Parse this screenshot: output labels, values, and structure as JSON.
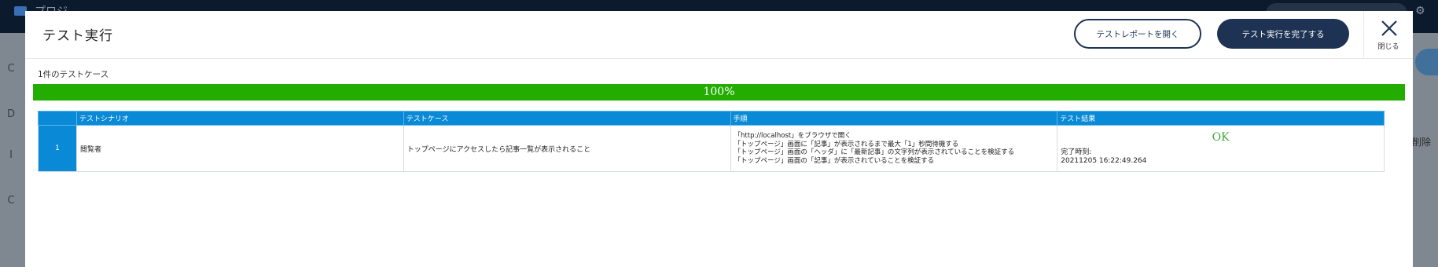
{
  "background": {
    "project_label": "プロジ",
    "left_marks": [
      "C",
      "D",
      "I",
      "C"
    ],
    "right_text": "削除"
  },
  "modal": {
    "title": "テスト実行",
    "report_button": "テストレポートを開く",
    "complete_button": "テスト実行を完了する",
    "close_label": "閉じる"
  },
  "summary": {
    "case_count": "1件のテストケース",
    "progress_percent": 100,
    "progress_text": "100%"
  },
  "table": {
    "headers": [
      "",
      "テストシナリオ",
      "テストケース",
      "手順",
      "テスト結果"
    ],
    "rows": [
      {
        "number": "1",
        "scenario": "閲覧者",
        "case": "トップページにアクセスしたら記事一覧が表示されること",
        "steps": [
          "「http://localhost」をブラウザで開く",
          "「トップページ」画面に「記事」が表示されるまで最大「1」秒間待機する",
          "「トップページ」画面の「ヘッダ」に「最新記事」の文字列が表示されていることを検証する",
          "「トップページ」画面の「記事」が表示されていることを検証する"
        ],
        "result": "OK",
        "completed_label": "完了時刻:",
        "completed_time": "20211205 16:22:49.264"
      }
    ]
  },
  "colors": {
    "navy": "#1e3354",
    "progress_green": "#22ad00",
    "header_blue": "#0a8ad6",
    "ok_green": "#3fa83a"
  }
}
